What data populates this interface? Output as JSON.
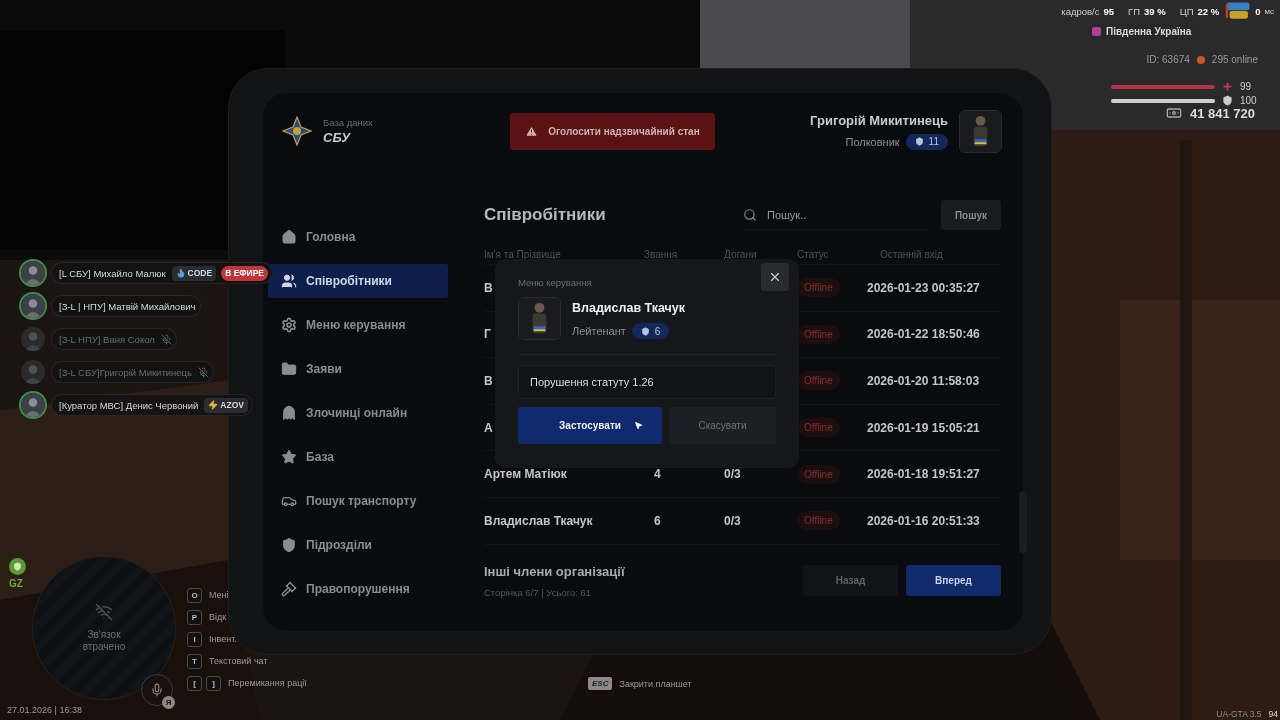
{
  "hud": {
    "fps_label": "кадров/с",
    "fps": "95",
    "gpu_label": "ГП",
    "gpu": "39 %",
    "cpu_label": "ЦП",
    "cpu": "22 %",
    "ping": "0",
    "ping_unit": "мс",
    "server": "Південна Україна",
    "player_id": "ID: 63674",
    "online": "295 online",
    "health": {
      "value": "99",
      "level": 0.99
    },
    "armor": {
      "value": "100",
      "level": 1
    },
    "money": "41 841 720"
  },
  "voice_chat": [
    {
      "name": "[L СБУ] Михайло Малюк",
      "muted": false,
      "tags": [
        {
          "kind": "flame",
          "label": "CODE"
        },
        {
          "kind": "live",
          "label": "В ЕФИРЕ"
        }
      ]
    },
    {
      "name": "[З-L | НПУ] Матвій Михайлович",
      "muted": false
    },
    {
      "name": "[З-L НПУ] Ваня Сокол",
      "muted": true
    },
    {
      "name": "[З-L СБУ]Григорій Микитинець",
      "muted": true
    },
    {
      "name": "[Куратор МВС] Денис Червоний",
      "muted": false,
      "tags": [
        {
          "kind": "bolt",
          "label": "AZOV"
        }
      ]
    }
  ],
  "tablet": {
    "logo": {
      "caption": "База даних",
      "title": "СБУ"
    },
    "alert_button": "Оголосити надзвичайний стан",
    "user": {
      "name": "Григорій Микитинець",
      "rank": "Полковник",
      "rank_number": "11"
    },
    "sidebar": [
      {
        "label": "Головна",
        "selected": false
      },
      {
        "label": "Співробітники",
        "selected": true
      },
      {
        "label": "Меню керування",
        "selected": false
      },
      {
        "label": "Заяви",
        "selected": false
      },
      {
        "label": "Злочинці онлайн",
        "selected": false
      },
      {
        "label": "База",
        "selected": false
      },
      {
        "label": "Пошук транспорту",
        "selected": false
      },
      {
        "label": "Підрозділи",
        "selected": false
      },
      {
        "label": "Правопорушення",
        "selected": false
      }
    ],
    "title": "Співробітники",
    "search": {
      "placeholder": "Пошук..",
      "button": "Пошук"
    },
    "table": {
      "columns": [
        "Ім'я та Прізвище",
        "Звання",
        "Догани",
        "Статус",
        "Останній вхід"
      ],
      "rows": [
        {
          "name": "В",
          "status": "Offline",
          "online": false,
          "last_login": "2026-01-23 00:35:27"
        },
        {
          "name": "Г",
          "status": "Offline",
          "online": false,
          "last_login": "2026-01-22 18:50:46"
        },
        {
          "name": "В",
          "status": "Offline",
          "online": false,
          "last_login": "2026-01-20 11:58:03"
        },
        {
          "name": "А",
          "status": "Offline",
          "online": false,
          "last_login": "2026-01-19 15:05:21"
        },
        {
          "name": "Артем Матіюк",
          "rank": "4",
          "warnings": "0/3",
          "status": "Offline",
          "online": false,
          "last_login": "2026-01-18 19:51:27"
        },
        {
          "name": "Владислав Ткачук",
          "rank": "6",
          "warnings": "0/3",
          "status": "Offline",
          "online": false,
          "last_login": "2026-01-16 20:51:33"
        }
      ]
    },
    "footer": {
      "title": "Інші члени організації",
      "page_info": "Сторінка 6/7 | Усього: 61"
    },
    "pagination": [
      {
        "label": "Назад",
        "primary": false
      },
      {
        "label": "Вперед",
        "primary": true
      }
    ],
    "modal": {
      "title": "Меню керування",
      "member": {
        "name": "Владислав Ткачук",
        "rank": "Лейтенант",
        "rank_number": "6"
      },
      "input_value": "Порушення статуту 1.26",
      "buttons": [
        {
          "label": "Застосувати",
          "primary": true
        },
        {
          "label": "Скасувати",
          "primary": false
        }
      ]
    }
  },
  "gz": "GZ",
  "minimap_status": "Зв'язок втрачено",
  "voice_key": "Я",
  "datetime": "27.01.2026 | 16:38",
  "key_hints": [
    {
      "keys": [
        "O"
      ],
      "label": "Мені"
    },
    {
      "keys": [
        "P"
      ],
      "label": "Відк"
    },
    {
      "keys": [
        "I"
      ],
      "label": "Інвент."
    },
    {
      "keys": [
        "T"
      ],
      "label": "Текстовий чат"
    },
    {
      "keys": [
        "[",
        "]"
      ],
      "label": "Перемикання рації"
    }
  ],
  "close_hint": {
    "key": "ESC",
    "label": "Закрити планшет"
  },
  "build": {
    "version": "UA-GTA 3.5",
    "fps": "94"
  }
}
